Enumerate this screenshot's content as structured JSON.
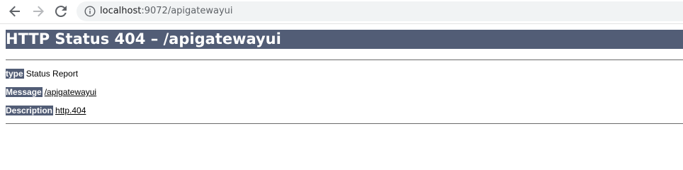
{
  "browser": {
    "back_icon": "arrow-left-icon",
    "forward_icon": "arrow-right-icon",
    "reload_icon": "reload-icon",
    "site_info_icon": "info-circle-icon",
    "url_host": "localhost",
    "url_rest": ":9072/apigatewayui"
  },
  "page": {
    "title": "HTTP Status 404 – /apigatewayui",
    "rows": [
      {
        "label": "type",
        "value": "Status Report",
        "is_link": false
      },
      {
        "label": "Message",
        "value": "/apigatewayui",
        "is_link": true
      },
      {
        "label": "Description",
        "value": "http.404",
        "is_link": true
      }
    ],
    "colors": {
      "header_bg": "#525d76",
      "header_text": "#ffffff"
    }
  }
}
